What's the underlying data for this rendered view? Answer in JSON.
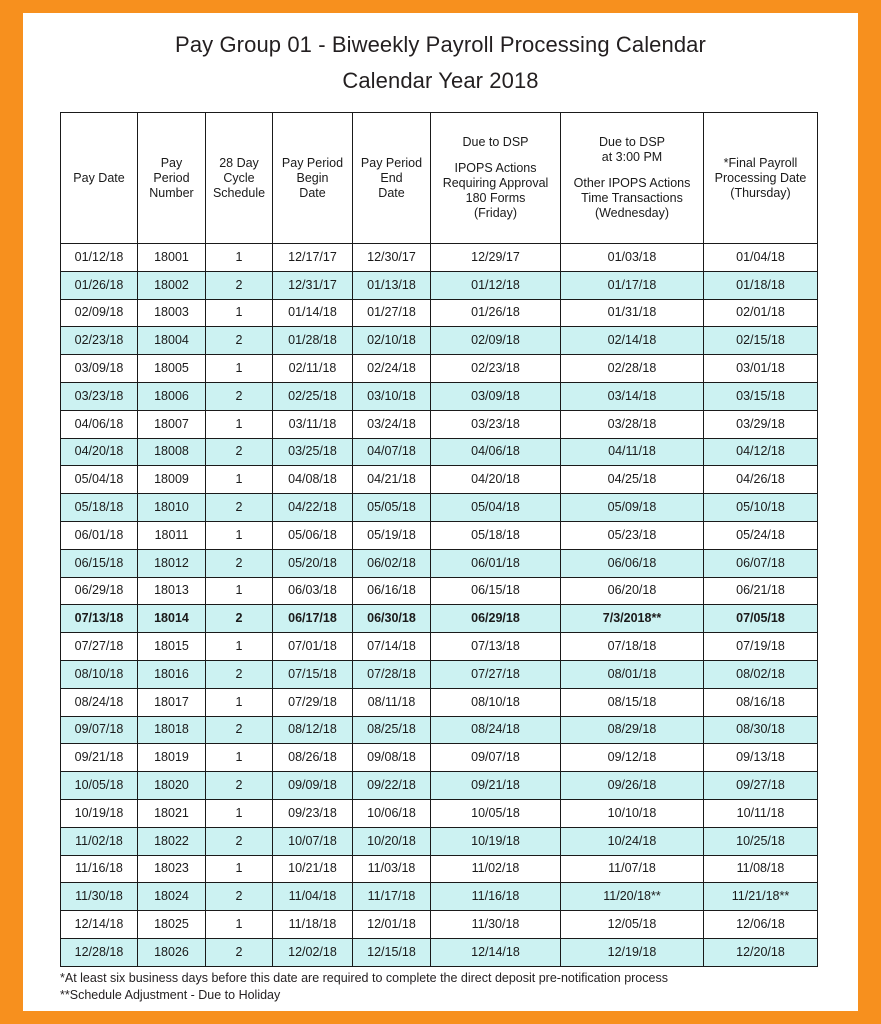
{
  "document": {
    "title_line_1": "Pay Group 01 - Biweekly Payroll Processing Calendar",
    "title_line_2": "Calendar Year 2018"
  },
  "table": {
    "headers": [
      {
        "top": "",
        "gap": false,
        "body": "Pay Date"
      },
      {
        "top": "",
        "gap": false,
        "body": "Pay\nPeriod\nNumber"
      },
      {
        "top": "",
        "gap": false,
        "body": "28 Day\nCycle\nSchedule"
      },
      {
        "top": "",
        "gap": false,
        "body": "Pay Period\nBegin\nDate"
      },
      {
        "top": "",
        "gap": false,
        "body": "Pay Period\nEnd\nDate"
      },
      {
        "top": "Due to DSP",
        "gap": true,
        "body": "IPOPS Actions\nRequiring Approval\n180 Forms\n(Friday)"
      },
      {
        "top": "Due to DSP\nat 3:00 PM",
        "gap": true,
        "body": "Other IPOPS Actions\nTime Transactions\n(Wednesday)"
      },
      {
        "top": "",
        "gap": false,
        "body": "*Final Payroll\nProcessing Date\n(Thursday)"
      }
    ],
    "header_labels": [
      "Pay Date",
      "Pay Period Number",
      "28 Day Cycle Schedule",
      "Pay Period Begin Date",
      "Pay Period End Date",
      "Due to DSP IPOPS Actions Requiring Approval 180 Forms (Friday)",
      "Due to DSP at 3:00 PM Other IPOPS Actions Time Transactions (Wednesday)",
      "*Final Payroll Processing Date (Thursday)"
    ],
    "rows": [
      {
        "shaded": false,
        "bold": false,
        "cells": [
          "01/12/18",
          "18001",
          "1",
          "12/17/17",
          "12/30/17",
          "12/29/17",
          "01/03/18",
          "01/04/18"
        ]
      },
      {
        "shaded": true,
        "bold": false,
        "cells": [
          "01/26/18",
          "18002",
          "2",
          "12/31/17",
          "01/13/18",
          "01/12/18",
          "01/17/18",
          "01/18/18"
        ]
      },
      {
        "shaded": false,
        "bold": false,
        "cells": [
          "02/09/18",
          "18003",
          "1",
          "01/14/18",
          "01/27/18",
          "01/26/18",
          "01/31/18",
          "02/01/18"
        ]
      },
      {
        "shaded": true,
        "bold": false,
        "cells": [
          "02/23/18",
          "18004",
          "2",
          "01/28/18",
          "02/10/18",
          "02/09/18",
          "02/14/18",
          "02/15/18"
        ]
      },
      {
        "shaded": false,
        "bold": false,
        "cells": [
          "03/09/18",
          "18005",
          "1",
          "02/11/18",
          "02/24/18",
          "02/23/18",
          "02/28/18",
          "03/01/18"
        ]
      },
      {
        "shaded": true,
        "bold": false,
        "cells": [
          "03/23/18",
          "18006",
          "2",
          "02/25/18",
          "03/10/18",
          "03/09/18",
          "03/14/18",
          "03/15/18"
        ]
      },
      {
        "shaded": false,
        "bold": false,
        "cells": [
          "04/06/18",
          "18007",
          "1",
          "03/11/18",
          "03/24/18",
          "03/23/18",
          "03/28/18",
          "03/29/18"
        ]
      },
      {
        "shaded": true,
        "bold": false,
        "cells": [
          "04/20/18",
          "18008",
          "2",
          "03/25/18",
          "04/07/18",
          "04/06/18",
          "04/11/18",
          "04/12/18"
        ]
      },
      {
        "shaded": false,
        "bold": false,
        "cells": [
          "05/04/18",
          "18009",
          "1",
          "04/08/18",
          "04/21/18",
          "04/20/18",
          "04/25/18",
          "04/26/18"
        ]
      },
      {
        "shaded": true,
        "bold": false,
        "cells": [
          "05/18/18",
          "18010",
          "2",
          "04/22/18",
          "05/05/18",
          "05/04/18",
          "05/09/18",
          "05/10/18"
        ]
      },
      {
        "shaded": false,
        "bold": false,
        "cells": [
          "06/01/18",
          "18011",
          "1",
          "05/06/18",
          "05/19/18",
          "05/18/18",
          "05/23/18",
          "05/24/18"
        ]
      },
      {
        "shaded": true,
        "bold": false,
        "cells": [
          "06/15/18",
          "18012",
          "2",
          "05/20/18",
          "06/02/18",
          "06/01/18",
          "06/06/18",
          "06/07/18"
        ]
      },
      {
        "shaded": false,
        "bold": false,
        "cells": [
          "06/29/18",
          "18013",
          "1",
          "06/03/18",
          "06/16/18",
          "06/15/18",
          "06/20/18",
          "06/21/18"
        ]
      },
      {
        "shaded": true,
        "bold": true,
        "cells": [
          "07/13/18",
          "18014",
          "2",
          "06/17/18",
          "06/30/18",
          "06/29/18",
          "7/3/2018**",
          "07/05/18"
        ]
      },
      {
        "shaded": false,
        "bold": false,
        "cells": [
          "07/27/18",
          "18015",
          "1",
          "07/01/18",
          "07/14/18",
          "07/13/18",
          "07/18/18",
          "07/19/18"
        ]
      },
      {
        "shaded": true,
        "bold": false,
        "cells": [
          "08/10/18",
          "18016",
          "2",
          "07/15/18",
          "07/28/18",
          "07/27/18",
          "08/01/18",
          "08/02/18"
        ]
      },
      {
        "shaded": false,
        "bold": false,
        "cells": [
          "08/24/18",
          "18017",
          "1",
          "07/29/18",
          "08/11/18",
          "08/10/18",
          "08/15/18",
          "08/16/18"
        ]
      },
      {
        "shaded": true,
        "bold": false,
        "cells": [
          "09/07/18",
          "18018",
          "2",
          "08/12/18",
          "08/25/18",
          "08/24/18",
          "08/29/18",
          "08/30/18"
        ]
      },
      {
        "shaded": false,
        "bold": false,
        "cells": [
          "09/21/18",
          "18019",
          "1",
          "08/26/18",
          "09/08/18",
          "09/07/18",
          "09/12/18",
          "09/13/18"
        ]
      },
      {
        "shaded": true,
        "bold": false,
        "cells": [
          "10/05/18",
          "18020",
          "2",
          "09/09/18",
          "09/22/18",
          "09/21/18",
          "09/26/18",
          "09/27/18"
        ]
      },
      {
        "shaded": false,
        "bold": false,
        "cells": [
          "10/19/18",
          "18021",
          "1",
          "09/23/18",
          "10/06/18",
          "10/05/18",
          "10/10/18",
          "10/11/18"
        ]
      },
      {
        "shaded": true,
        "bold": false,
        "cells": [
          "11/02/18",
          "18022",
          "2",
          "10/07/18",
          "10/20/18",
          "10/19/18",
          "10/24/18",
          "10/25/18"
        ]
      },
      {
        "shaded": false,
        "bold": false,
        "cells": [
          "11/16/18",
          "18023",
          "1",
          "10/21/18",
          "11/03/18",
          "11/02/18",
          "11/07/18",
          "11/08/18"
        ]
      },
      {
        "shaded": true,
        "bold": false,
        "cells": [
          "11/30/18",
          "18024",
          "2",
          "11/04/18",
          "11/17/18",
          "11/16/18",
          "11/20/18**",
          "11/21/18**"
        ]
      },
      {
        "shaded": false,
        "bold": false,
        "cells": [
          "12/14/18",
          "18025",
          "1",
          "11/18/18",
          "12/01/18",
          "11/30/18",
          "12/05/18",
          "12/06/18"
        ]
      },
      {
        "shaded": true,
        "bold": false,
        "cells": [
          "12/28/18",
          "18026",
          "2",
          "12/02/18",
          "12/15/18",
          "12/14/18",
          "12/19/18",
          "12/20/18"
        ]
      }
    ]
  },
  "footnotes": [
    "*At least six business days before this date are required to complete the direct deposit pre-notification process",
    "**Schedule Adjustment - Due to Holiday"
  ],
  "colors": {
    "border_accent": "#F7901E",
    "row_shade": "#CCF2F2",
    "text": "#1a1a1a",
    "grid": "#1a1a1a"
  }
}
